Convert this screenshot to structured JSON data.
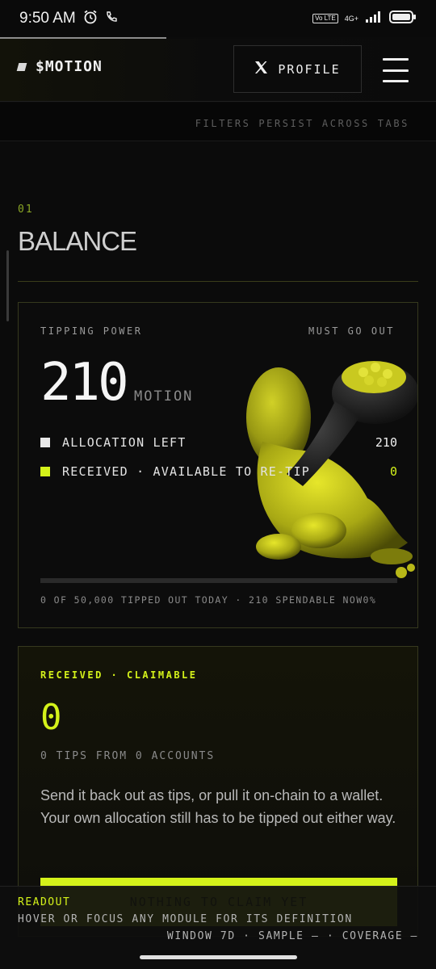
{
  "status": {
    "time": "9:50 AM",
    "volte": "Vo LTE",
    "network": "4G+"
  },
  "header": {
    "brand": "$MOTION",
    "profile_label": "PROFILE"
  },
  "subbar": {
    "note": "FILTERS PERSIST ACROSS TABS"
  },
  "section": {
    "number": "01",
    "title": "BALANCE"
  },
  "power": {
    "label": "TIPPING POWER",
    "tag": "MUST GO OUT",
    "amount": "210",
    "unit": "MOTION",
    "legend": [
      {
        "label": "ALLOCATION LEFT",
        "value": "210",
        "color": "#e8e8e8",
        "value_color": "#f0f0f0"
      },
      {
        "label": "RECEIVED · AVAILABLE TO RE-TIP",
        "value": "0",
        "color": "#d4f21a",
        "value_color": "#d4f21a"
      }
    ],
    "progress_percent": 0,
    "footnote": "0 OF 50,000 TIPPED OUT TODAY · 210 SPENDABLE NOW0%"
  },
  "claim": {
    "label": "RECEIVED · CLAIMABLE",
    "amount": "0",
    "sub": "0 TIPS FROM 0 ACCOUNTS",
    "body": "Send it back out as tips, or pull it on-chain to a wallet. Your own allocation still has to be tipped out either way.",
    "button_label": "NOTHING TO CLAIM YET"
  },
  "readout": {
    "label": "READOUT",
    "text": "HOVER OR FOCUS ANY MODULE FOR ITS DEFINITION",
    "meta": "WINDOW 7D · SAMPLE — · COVERAGE —"
  },
  "colors": {
    "accent": "#d4f21a",
    "background": "#0b0b0b",
    "border": "#36391e"
  },
  "icons": [
    "alarm-icon",
    "phone-icon",
    "signal-icon",
    "battery-icon",
    "x-logo-icon",
    "hamburger-menu-icon"
  ]
}
